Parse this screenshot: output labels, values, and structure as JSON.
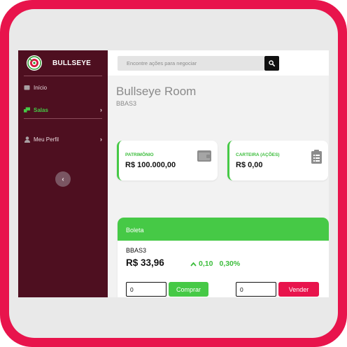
{
  "app": {
    "brand": "BULLSEYE",
    "icons": {
      "logo": "bullseye-logo",
      "search": "search-icon"
    }
  },
  "colors": {
    "frame": "#e8144c",
    "sidebar": "#4e0f20",
    "accent_green": "#46c946",
    "sell_red": "#e8144c"
  },
  "sidebar": {
    "items": [
      {
        "label": "Início",
        "icon": "home-icon",
        "has_chevron": false,
        "active": false
      },
      {
        "label": "Salas",
        "icon": "rooms-icon",
        "has_chevron": true,
        "active": true
      },
      {
        "label": "Meu Perfil",
        "icon": "user-icon",
        "has_chevron": true,
        "active": false
      }
    ],
    "collapse_icon": "chevron-left-icon"
  },
  "search": {
    "placeholder": "Encontre ações para negociar"
  },
  "room": {
    "title": "Bullseye Room",
    "ticker": "BBAS3"
  },
  "cards": [
    {
      "label": "PATRIMÔNIO",
      "value": "R$ 100.000,00",
      "icon": "wallet-icon"
    },
    {
      "label": "CARTEIRA (AÇÕES)",
      "value": "R$ 0,00",
      "icon": "clipboard-icon"
    }
  ],
  "boleta": {
    "header": "Boleta",
    "ticker": "BBAS3",
    "price": "R$ 33,96",
    "change_value": "0,10",
    "change_percent": "0,30%",
    "change_icon": "arrow-up-icon",
    "buy_qty": "0",
    "buy_label": "Comprar",
    "sell_qty": "0",
    "sell_label": "Vender"
  }
}
